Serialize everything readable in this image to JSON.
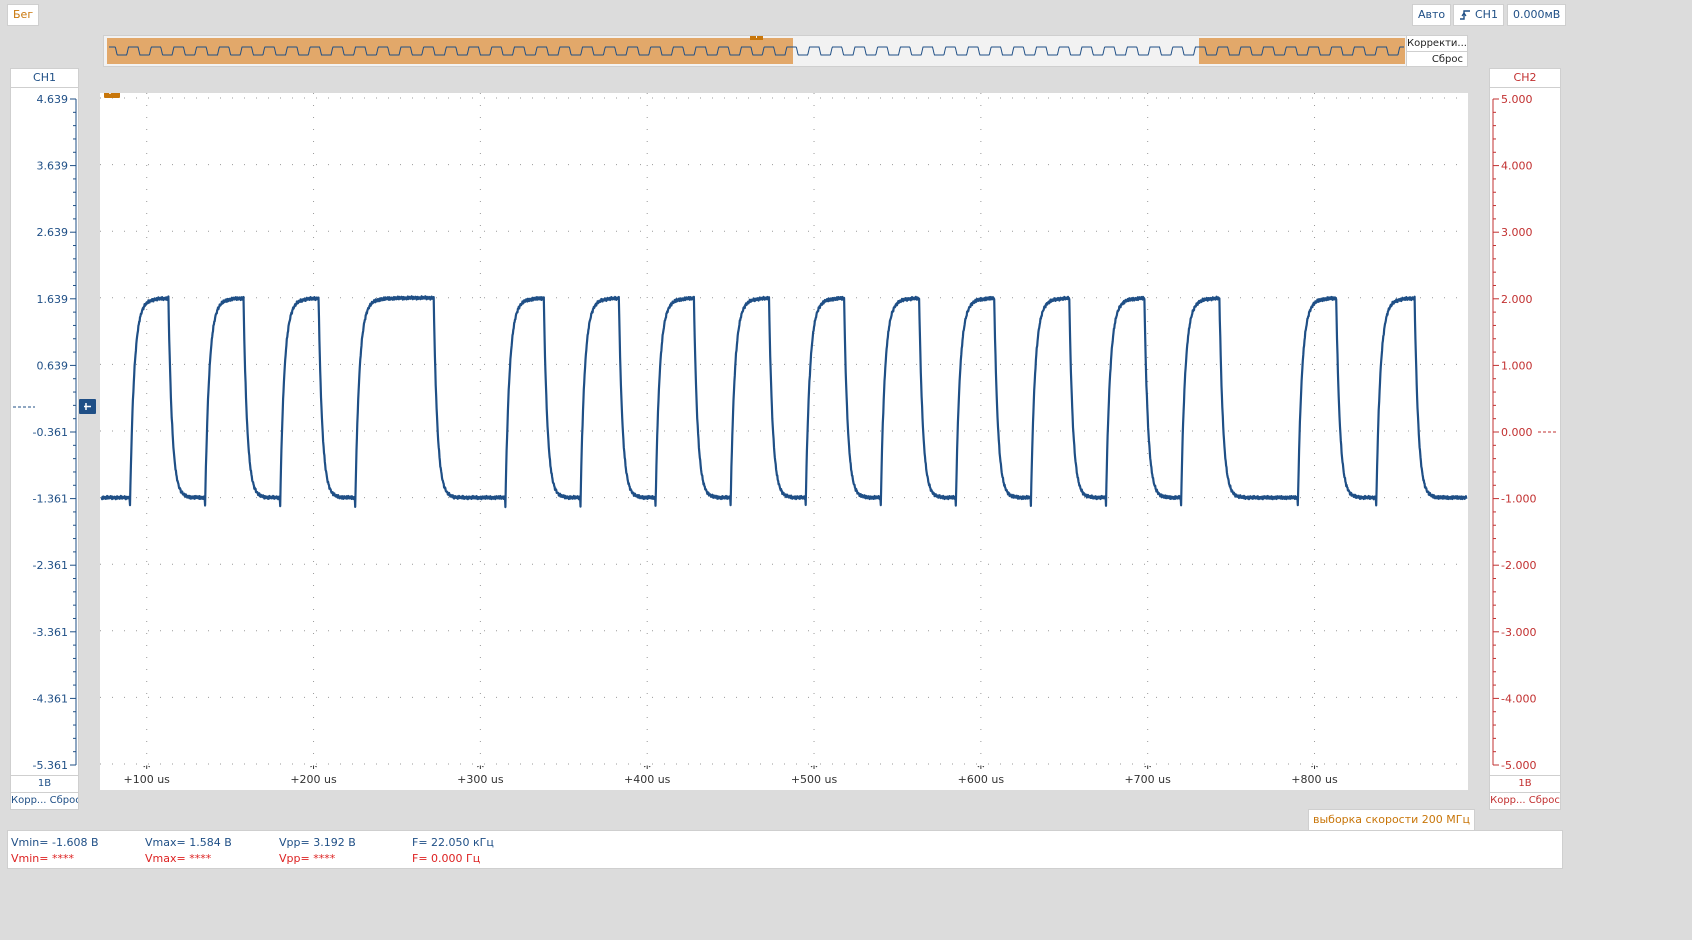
{
  "toolbar": {
    "run_status": "Бег",
    "trigger_mode": "Авто",
    "trigger_source": "CH1",
    "trigger_level": "0.000мВ"
  },
  "overview": {
    "trigger_marker": "T",
    "side_labels": [
      "Корректи...",
      "Сброс"
    ]
  },
  "ch1": {
    "title": "CH1",
    "volts_div": "1В",
    "auto": "Корр...",
    "reset": "Сброс",
    "ticks": [
      "4.639",
      "3.639",
      "2.639",
      "1.639",
      "0.639",
      "-0.361",
      "-1.361",
      "-2.361",
      "-3.361",
      "-4.361",
      "-5.361"
    ],
    "color": "#1f4f86"
  },
  "ch2": {
    "title": "CH2",
    "volts_div": "1В",
    "auto": "Корр...",
    "reset": "Сброс",
    "ticks": [
      "5.000",
      "4.000",
      "3.000",
      "2.000",
      "1.000",
      "0.000",
      "-1.000",
      "-2.000",
      "-3.000",
      "-4.000",
      "-5.000"
    ],
    "color": "#c23030"
  },
  "sample_rate": "выборка скорости 200 МГц",
  "measurements": {
    "ch1": {
      "vmin": "Vmin= -1.608 В",
      "vmax": "Vmax= 1.584 В",
      "vpp": "Vpp= 3.192 В",
      "freq": "F= 22.050 кГц"
    },
    "ch2": {
      "vmin": "Vmin= ****",
      "vmax": "Vmax= ****",
      "vpp": "Vpp= ****",
      "freq": "F= 0.000 Гц"
    }
  },
  "chart_data": {
    "type": "line",
    "title": "",
    "xlabel": "",
    "ylabel": "",
    "x_ticks": [
      "+100 us",
      "+200 us",
      "+300 us",
      "+400 us",
      "+500 us",
      "+600 us",
      "+700 us",
      "+800 us"
    ],
    "xlim_us": [
      72,
      892
    ],
    "ylim": [
      -5.361,
      4.639
    ],
    "grid": true,
    "series": [
      {
        "color": "#1f4f86",
        "low_v": -1.361,
        "high_v": 1.639,
        "rising_edges_us": [
          90,
          135,
          180,
          225,
          315,
          360,
          405,
          450,
          495,
          540,
          585,
          630,
          675,
          720,
          790,
          837
        ],
        "falling_edges_us": [
          113,
          158,
          203,
          272,
          338,
          383,
          428,
          473,
          518,
          563,
          608,
          653,
          698,
          743,
          813,
          860
        ]
      }
    ]
  }
}
